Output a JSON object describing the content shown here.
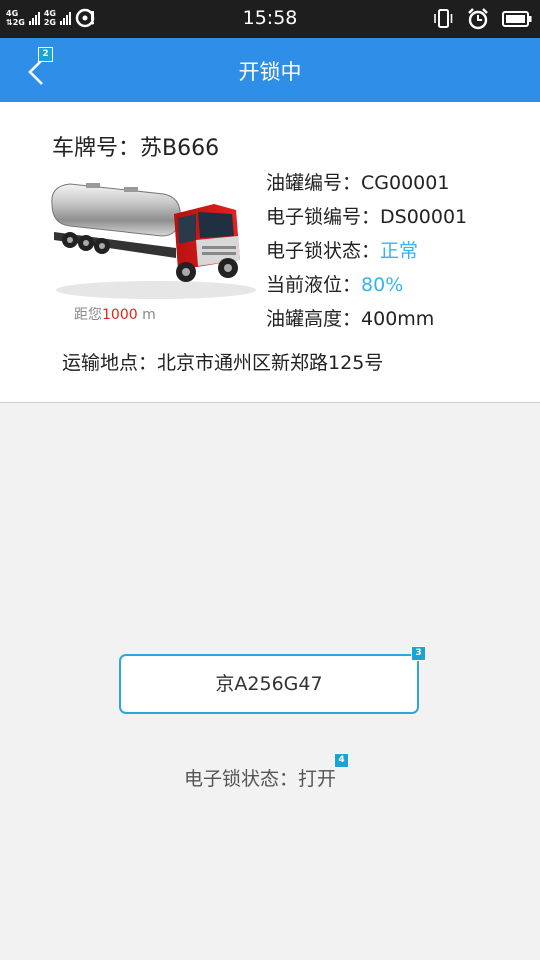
{
  "status_bar": {
    "time": "15:58",
    "signal1": "4G",
    "signal2": "4G",
    "signal3": "2G",
    "signal4": "2G"
  },
  "app_bar": {
    "title": "开锁中",
    "back_badge": "2",
    "background": "#2f8fe8"
  },
  "vehicle": {
    "plate_label": "车牌号：",
    "plate_value": "苏B666",
    "distance_prefix": "距您",
    "distance_value": "1000",
    "distance_unit": " m",
    "tank_no_label": "油罐编号：",
    "tank_no_value": "CG00001",
    "lock_no_label": "电子锁编号：",
    "lock_no_value": "DS00001",
    "lock_state_label": "电子锁状态：",
    "lock_state_value": "正常",
    "level_label": "当前液位：",
    "level_value": "80%",
    "height_label": "油罐高度：",
    "height_value": "400mm",
    "address_label": "运输地点：",
    "address_value": "北京市通州区新郑路125号"
  },
  "lock_panel": {
    "plate_button": "京A256G47",
    "plate_badge": "3",
    "status_label": "电子锁状态：",
    "status_value": "打开",
    "status_badge": "4"
  },
  "colors": {
    "accent": "#2ba6e0",
    "highlight": "#33b6f0",
    "distance_red": "#e1261c"
  }
}
